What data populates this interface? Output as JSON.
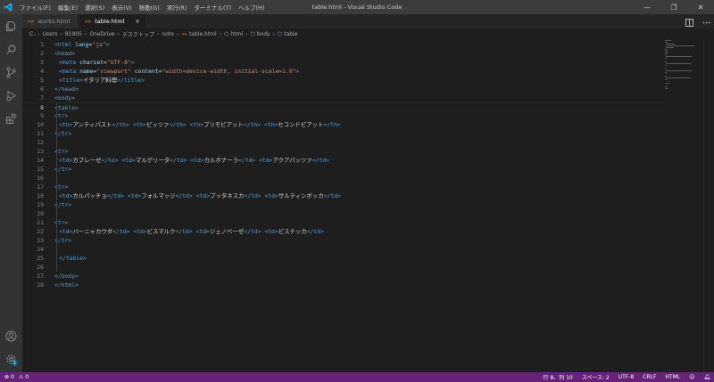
{
  "window": {
    "title": "table.html - Visual Studio Code",
    "menu": [
      "ファイル(F)",
      "編集(E)",
      "選択(S)",
      "表示(V)",
      "移動(G)",
      "実行(R)",
      "ターミナル(T)",
      "ヘルプ(H)"
    ],
    "controls": {
      "minimize": "—",
      "restore": "❐",
      "close": "✕"
    }
  },
  "activity_bar": [
    "explorer-icon",
    "search-icon",
    "source-control-icon",
    "run-debug-icon",
    "extensions-icon",
    "account-icon",
    "settings-gear-icon"
  ],
  "settings_badge": "1",
  "tabs": [
    {
      "label": "works.html",
      "icon": "<>",
      "active": false
    },
    {
      "label": "table.html",
      "icon": "<>",
      "active": true,
      "close": "×"
    }
  ],
  "breadcrumb": [
    "C:",
    "Users",
    "81905",
    "OneDrive",
    "デスクトップ",
    "note",
    "table.html",
    "html",
    "body",
    "table"
  ],
  "editor": {
    "current_line": 8,
    "lines": [
      {
        "n": "1",
        "indent": 0,
        "tokens": [
          [
            "t",
            "<html "
          ],
          [
            "a",
            "lang"
          ],
          [
            "x",
            "="
          ],
          [
            "s",
            "\"ja\""
          ],
          [
            "t",
            ">"
          ]
        ]
      },
      {
        "n": "2",
        "indent": 0,
        "tokens": [
          [
            "t",
            "<head>"
          ]
        ]
      },
      {
        "n": "3",
        "indent": 1,
        "tokens": [
          [
            "t",
            "<meta "
          ],
          [
            "a",
            "charset"
          ],
          [
            "x",
            "="
          ],
          [
            "s",
            "\"UTF-8\""
          ],
          [
            "t",
            ">"
          ]
        ]
      },
      {
        "n": "4",
        "indent": 1,
        "tokens": [
          [
            "t",
            "<meta "
          ],
          [
            "a",
            "name"
          ],
          [
            "x",
            "="
          ],
          [
            "s",
            "\"viewport\""
          ],
          [
            "x",
            " "
          ],
          [
            "a",
            "content"
          ],
          [
            "x",
            "="
          ],
          [
            "s",
            "\"width=device-width, initial-scale=1.0\""
          ],
          [
            "t",
            ">"
          ]
        ]
      },
      {
        "n": "5",
        "indent": 1,
        "tokens": [
          [
            "t",
            "<title>"
          ],
          [
            "x",
            "イタリア料理"
          ],
          [
            "t",
            "</title>"
          ]
        ]
      },
      {
        "n": "6",
        "indent": 0,
        "tokens": [
          [
            "t",
            "</head>"
          ]
        ]
      },
      {
        "n": "7",
        "indent": 0,
        "tokens": [
          [
            "t",
            "<body>"
          ]
        ]
      },
      {
        "n": "8",
        "indent": 0,
        "tokens": [
          [
            "t",
            "<table>"
          ]
        ]
      },
      {
        "n": "9",
        "indent": 0,
        "tokens": [
          [
            "t",
            "<tr>"
          ]
        ]
      },
      {
        "n": "10",
        "indent": 1,
        "tokens": [
          [
            "t",
            "<th>"
          ],
          [
            "x",
            "アンティパスト"
          ],
          [
            "t",
            "</th>"
          ],
          [
            "x",
            " "
          ],
          [
            "t",
            "<th>"
          ],
          [
            "x",
            "ピッツァ"
          ],
          [
            "t",
            "</th>"
          ],
          [
            "x",
            " "
          ],
          [
            "t",
            "<th>"
          ],
          [
            "x",
            "プリモピアット"
          ],
          [
            "t",
            "</th>"
          ],
          [
            "x",
            " "
          ],
          [
            "t",
            "<th>"
          ],
          [
            "x",
            "セコンドピアット"
          ],
          [
            "t",
            "</th>"
          ]
        ]
      },
      {
        "n": "11",
        "indent": 0,
        "tokens": [
          [
            "t",
            "</tr>"
          ]
        ]
      },
      {
        "n": "12",
        "indent": 0,
        "tokens": []
      },
      {
        "n": "13",
        "indent": 0,
        "tokens": [
          [
            "t",
            "<tr>"
          ]
        ]
      },
      {
        "n": "14",
        "indent": 1,
        "tokens": [
          [
            "t",
            "<td>"
          ],
          [
            "x",
            "カプレーゼ"
          ],
          [
            "t",
            "</td>"
          ],
          [
            "x",
            " "
          ],
          [
            "t",
            "<td>"
          ],
          [
            "x",
            "マルゲリータ"
          ],
          [
            "t",
            "</td>"
          ],
          [
            "x",
            " "
          ],
          [
            "t",
            "<td>"
          ],
          [
            "x",
            "カルボナーラ"
          ],
          [
            "t",
            "</td>"
          ],
          [
            "x",
            " "
          ],
          [
            "t",
            "<td>"
          ],
          [
            "x",
            "アクアパッツァ"
          ],
          [
            "t",
            "</td>"
          ]
        ]
      },
      {
        "n": "15",
        "indent": 0,
        "tokens": [
          [
            "t",
            "</tr>"
          ]
        ]
      },
      {
        "n": "16",
        "indent": 0,
        "tokens": []
      },
      {
        "n": "17",
        "indent": 0,
        "tokens": [
          [
            "t",
            "<tr>"
          ]
        ]
      },
      {
        "n": "18",
        "indent": 1,
        "tokens": [
          [
            "t",
            "<td>"
          ],
          [
            "x",
            "カルパッチョ"
          ],
          [
            "t",
            "</td>"
          ],
          [
            "x",
            " "
          ],
          [
            "t",
            "<td>"
          ],
          [
            "x",
            "フォルマッジ"
          ],
          [
            "t",
            "</td>"
          ],
          [
            "x",
            " "
          ],
          [
            "t",
            "<td>"
          ],
          [
            "x",
            "プッタネスカ"
          ],
          [
            "t",
            "</td>"
          ],
          [
            "x",
            " "
          ],
          [
            "t",
            "<td>"
          ],
          [
            "x",
            "サルティンボッカ"
          ],
          [
            "t",
            "</td>"
          ]
        ]
      },
      {
        "n": "19",
        "indent": 0,
        "tokens": [
          [
            "t",
            "</tr>"
          ]
        ]
      },
      {
        "n": "20",
        "indent": 0,
        "tokens": []
      },
      {
        "n": "21",
        "indent": 0,
        "tokens": [
          [
            "t",
            "<tr>"
          ]
        ]
      },
      {
        "n": "22",
        "indent": 1,
        "tokens": [
          [
            "t",
            "<td>"
          ],
          [
            "x",
            "バーニャカウダ"
          ],
          [
            "t",
            "</td>"
          ],
          [
            "x",
            " "
          ],
          [
            "t",
            "<td>"
          ],
          [
            "x",
            "ビスマルク"
          ],
          [
            "t",
            "</td>"
          ],
          [
            "x",
            " "
          ],
          [
            "t",
            "<td>"
          ],
          [
            "x",
            "ジェノベーゼ"
          ],
          [
            "t",
            "</td>"
          ],
          [
            "x",
            " "
          ],
          [
            "t",
            "<td>"
          ],
          [
            "x",
            "ビステッカ"
          ],
          [
            "t",
            "</td>"
          ]
        ]
      },
      {
        "n": "23",
        "indent": 0,
        "tokens": [
          [
            "t",
            "</tr>"
          ]
        ]
      },
      {
        "n": "24",
        "indent": 0,
        "tokens": []
      },
      {
        "n": "25",
        "indent": 1,
        "tokens": [
          [
            "t",
            "</table>"
          ]
        ]
      },
      {
        "n": "26",
        "indent": 0,
        "tokens": []
      },
      {
        "n": "27",
        "indent": 0,
        "tokens": [
          [
            "t",
            "</body>"
          ]
        ]
      },
      {
        "n": "28",
        "indent": 0,
        "tokens": [
          [
            "t",
            "</html>"
          ]
        ]
      }
    ]
  },
  "status_bar": {
    "errors": "0",
    "warnings": "0",
    "position": "行 8、列 10",
    "spaces": "スペース: 2",
    "encoding": "UTF-8",
    "eol": "CRLF",
    "language": "HTML"
  },
  "colors": {
    "statusbar_bg": "#68217a",
    "tag": "#569cd6",
    "attribute": "#9cdcfe",
    "string": "#ce9178",
    "html_icon": "#e37933"
  }
}
